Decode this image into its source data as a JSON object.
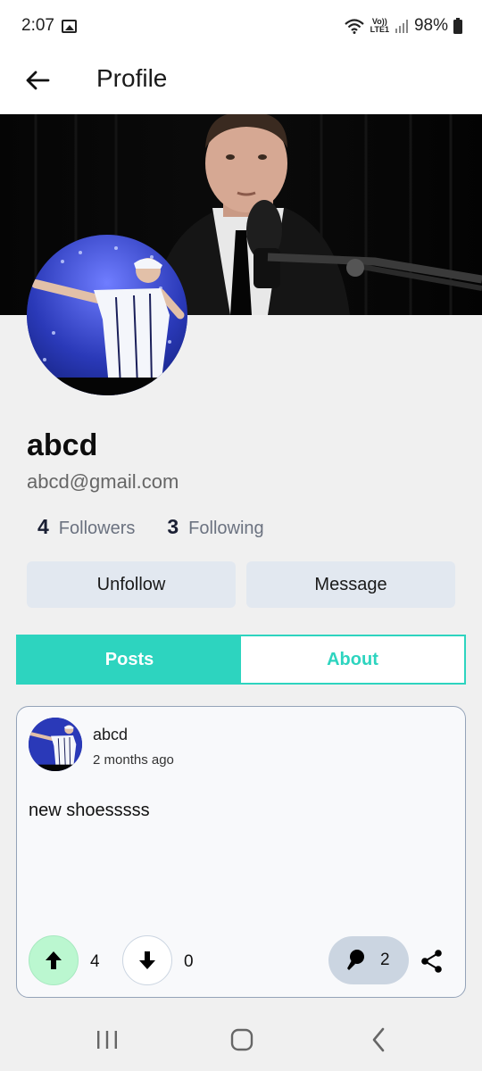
{
  "status_bar": {
    "time": "2:07",
    "volte_top": "Vo))",
    "volte_bottom": "LTE1",
    "battery": "98%"
  },
  "header": {
    "title": "Profile",
    "back_icon": "arrow-left-icon"
  },
  "profile": {
    "name": "abcd",
    "email": "abcd@gmail.com",
    "followers_count": "4",
    "followers_label": "Followers",
    "following_count": "3",
    "following_label": "Following",
    "unfollow_label": "Unfollow",
    "message_label": "Message"
  },
  "tabs": [
    {
      "label": "Posts",
      "active": true
    },
    {
      "label": "About",
      "active": false
    }
  ],
  "post": {
    "author": "abcd",
    "time": "2 months ago",
    "text": "new shoesssss",
    "upvotes": "4",
    "downvotes": "0",
    "pins": "2"
  },
  "colors": {
    "accent": "#2dd4bf",
    "upvote_bg": "#bbf7d0",
    "button_bg": "#e2e8f0",
    "pin_bg": "#cbd5e1"
  },
  "icons": {
    "upvote": "arrow-up-icon",
    "downvote": "arrow-down-icon",
    "pin": "pushpin-icon",
    "share": "share-icon"
  }
}
